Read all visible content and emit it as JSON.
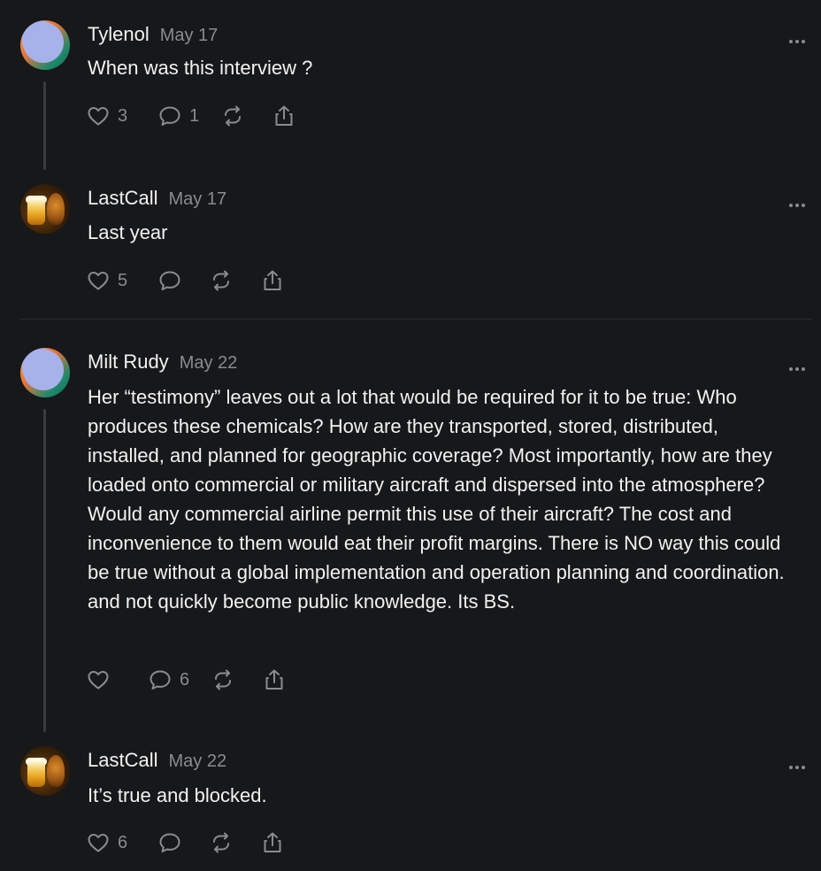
{
  "posts": [
    {
      "author": "Tylenol",
      "date": "May 17",
      "text": "When was this interview ?",
      "likes": "3",
      "replies": "1",
      "avatar": "default-avatar"
    },
    {
      "author": "LastCall",
      "date": "May 17",
      "text": "Last year",
      "likes": "5",
      "replies": "",
      "avatar": "beer-squirrel-avatar"
    },
    {
      "author": "Milt Rudy",
      "date": "May 22",
      "text": "Her “testimony” leaves out a lot that would be required for it to be true: Who produces these chemicals? How are they transported, stored, distributed, installed, and planned for geographic coverage? Most importantly, how are they loaded onto commercial or military aircraft and dispersed into the atmosphere? Would any commercial airline permit this use of their aircraft? The cost and inconvenience to them would eat their profit margins. There is NO way this could be true without a global implementation and operation planning and coordination. and not quickly become public knowledge. Its BS.",
      "likes": "",
      "replies": "6",
      "avatar": "default-avatar"
    },
    {
      "author": "LastCall",
      "date": "May 22",
      "text": "It’s true and blocked.",
      "likes": "6",
      "replies": "",
      "avatar": "beer-squirrel-avatar"
    }
  ],
  "icons": {
    "like": "heart-icon",
    "reply": "comment-icon",
    "repost": "repost-icon",
    "share": "share-icon",
    "more": "more-options-icon"
  },
  "colors": {
    "background": "#17181a",
    "text": "#f2f2f2",
    "muted": "#8a8b8f",
    "thread_line": "#3a3b3e"
  }
}
